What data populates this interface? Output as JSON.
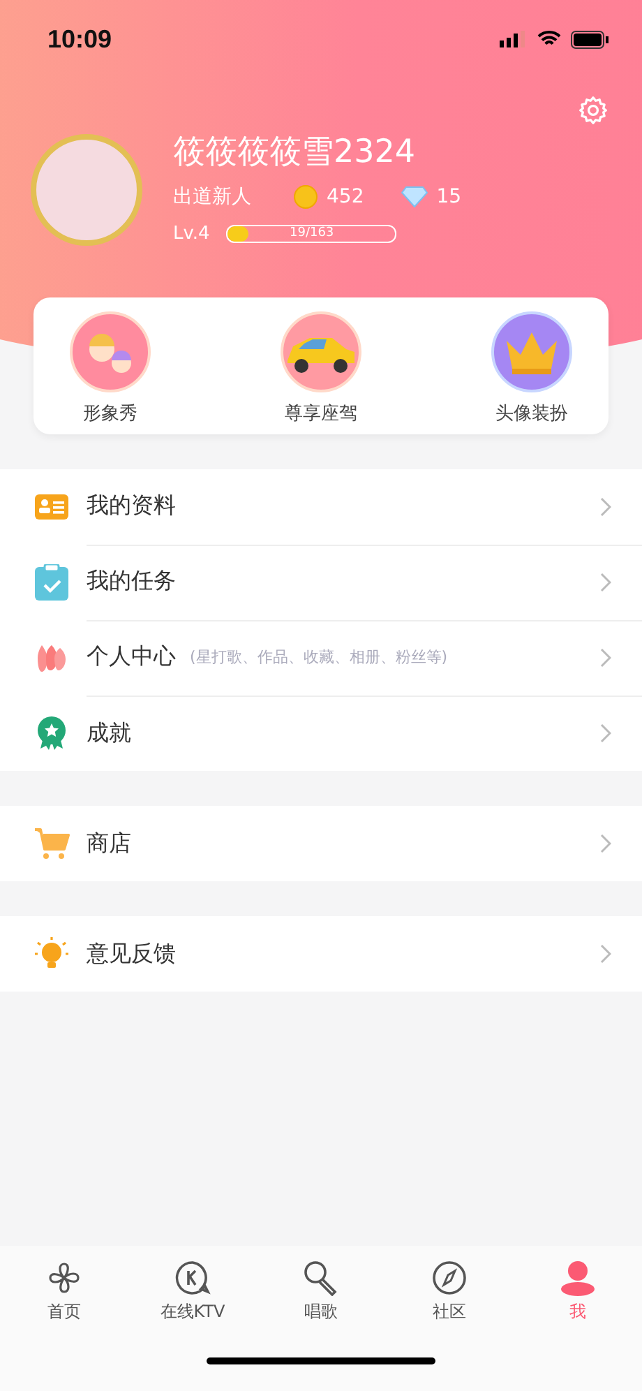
{
  "status_bar": {
    "time": "10:09"
  },
  "profile": {
    "name": "筱筱筱筱雪2324",
    "title": "出道新人",
    "coins": "452",
    "diamonds": "15",
    "level_label": "Lv.4",
    "progress": {
      "text": "19/163",
      "level": 0.12
    }
  },
  "features": [
    {
      "kind": "avatar-show",
      "label": "形象秀"
    },
    {
      "kind": "car",
      "label": "尊享座驾"
    },
    {
      "kind": "crown",
      "label": "头像装扮"
    }
  ],
  "menu_groups": [
    [
      {
        "kind": "profile",
        "label": "我的资料"
      },
      {
        "kind": "task",
        "label": "我的任务"
      },
      {
        "kind": "center",
        "label": "个人中心",
        "hint": "(星打歌、作品、收藏、相册、粉丝等)"
      },
      {
        "kind": "achievement",
        "label": "成就"
      }
    ],
    [
      {
        "kind": "shop",
        "label": "商店"
      }
    ],
    [
      {
        "kind": "feedback",
        "label": "意见反馈"
      }
    ]
  ],
  "tabs": [
    {
      "kind": "home",
      "label": "首页",
      "selected": false
    },
    {
      "kind": "ktv",
      "label": "在线KTV",
      "selected": false
    },
    {
      "kind": "sing",
      "label": "唱歌",
      "selected": false
    },
    {
      "kind": "community",
      "label": "社区",
      "selected": false
    },
    {
      "kind": "me",
      "label": "我",
      "selected": true
    }
  ]
}
